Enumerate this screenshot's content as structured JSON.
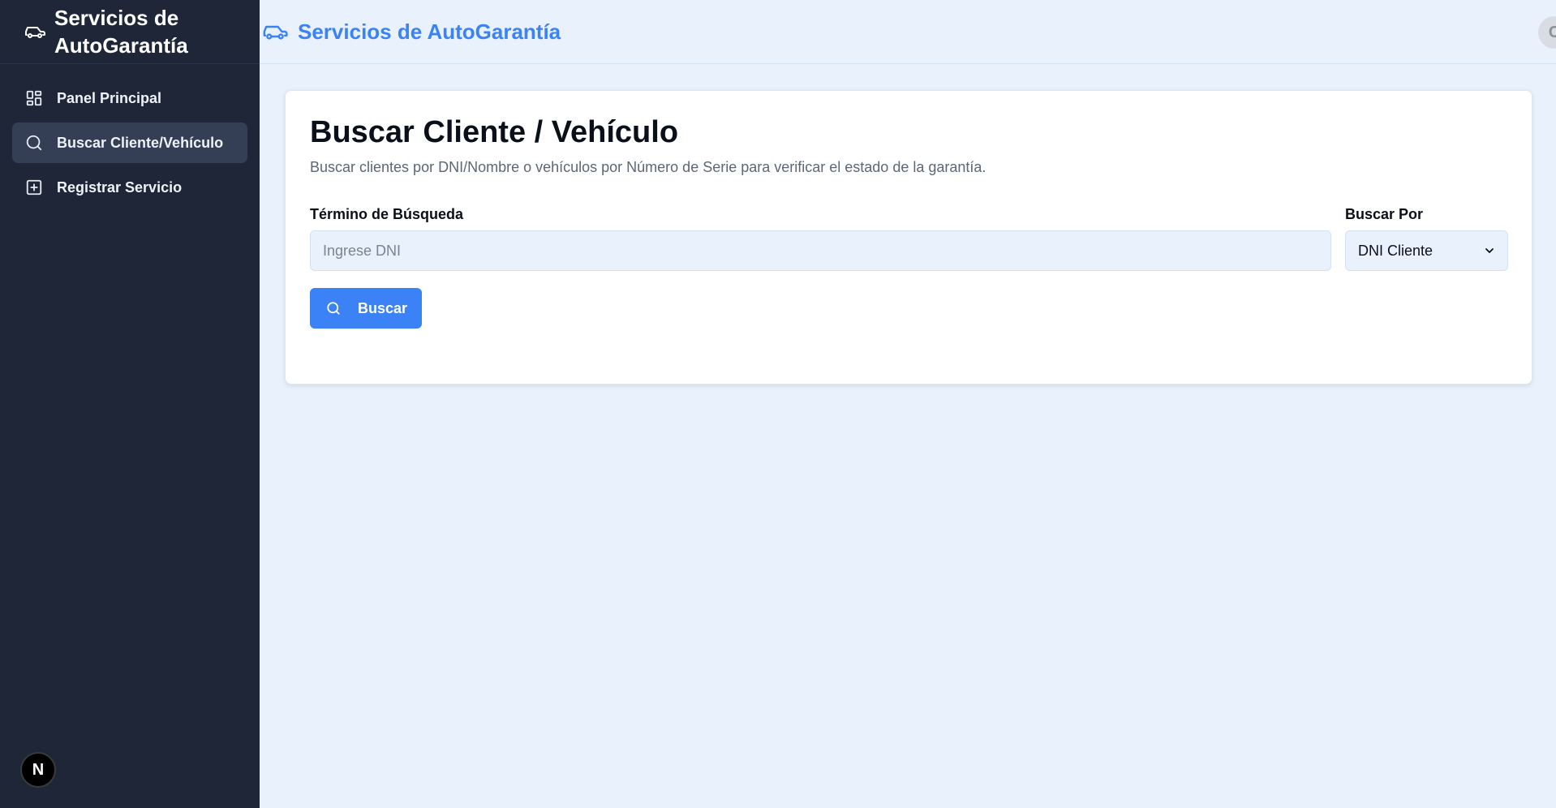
{
  "sidebar": {
    "brand_title": "Servicios de AutoGarantía",
    "brand_icon": "car-icon",
    "items": [
      {
        "label": "Panel Principal",
        "icon": "dashboard-icon",
        "active": false
      },
      {
        "label": "Buscar Cliente/Vehículo",
        "icon": "search-icon",
        "active": true
      },
      {
        "label": "Registrar Servicio",
        "icon": "plus-square-icon",
        "active": false
      }
    ],
    "badge": "N"
  },
  "header": {
    "title": "Servicios de AutoGarantía",
    "icon": "car-icon",
    "avatar_initial": "C"
  },
  "main": {
    "title": "Buscar Cliente / Vehículo",
    "subtitle": "Buscar clientes por DNI/Nombre o vehículos por Número de Serie para verificar el estado de la garantía.",
    "search_label": "Término de Búsqueda",
    "search_placeholder": "Ingrese DNI",
    "search_value": "",
    "search_by_label": "Buscar Por",
    "search_by_value": "DNI Cliente",
    "search_button": "Buscar"
  },
  "colors": {
    "accent": "#3b82f6",
    "sidebar_bg": "#1e2638",
    "sidebar_active": "#343f56",
    "page_bg": "#e8f1fc"
  }
}
